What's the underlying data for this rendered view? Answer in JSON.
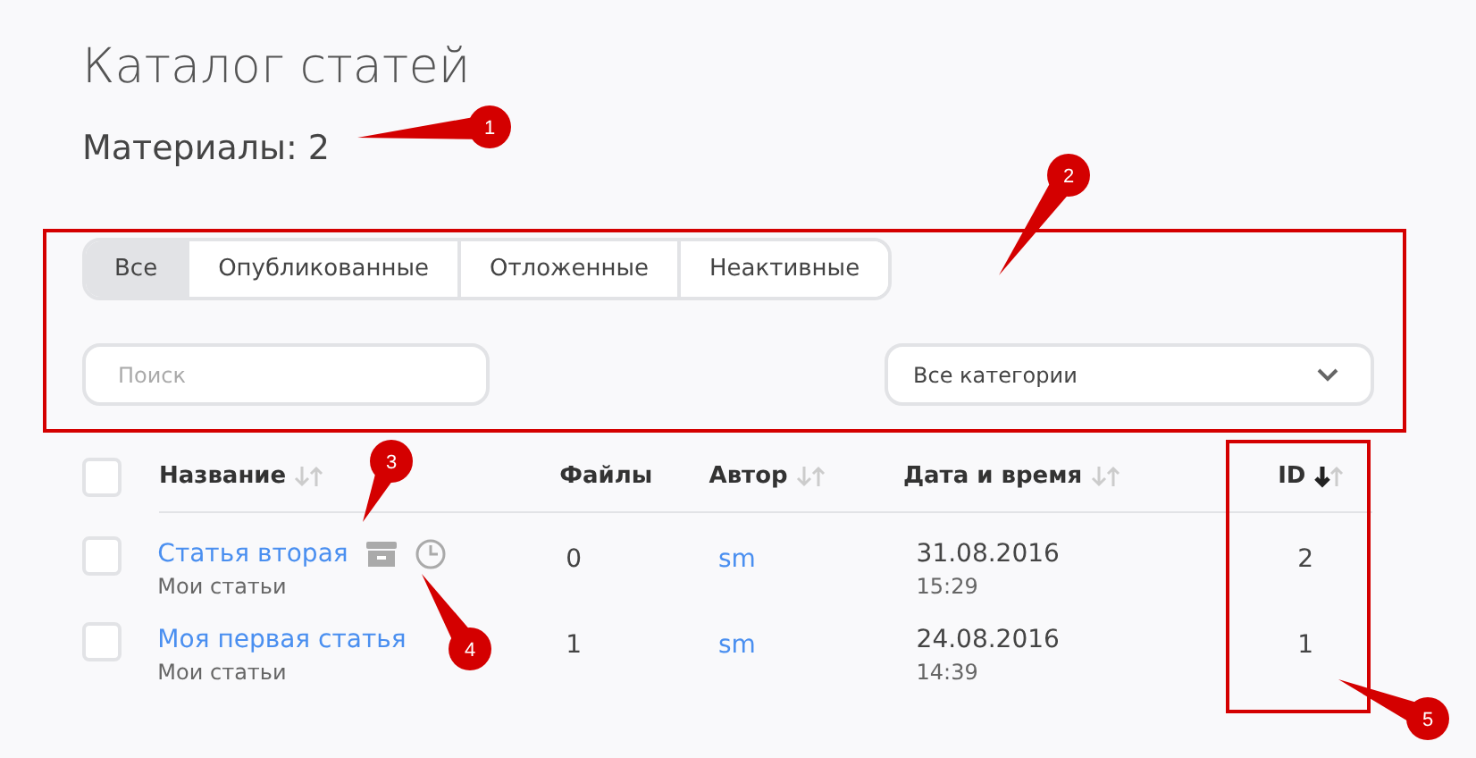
{
  "title": "Каталог статей",
  "materials": "Материалы: 2",
  "tabs": [
    {
      "label": "Все",
      "selected": true
    },
    {
      "label": "Опубликованные",
      "selected": false
    },
    {
      "label": "Отложенные",
      "selected": false
    },
    {
      "label": "Неактивные",
      "selected": false
    }
  ],
  "search": {
    "placeholder": "Поиск"
  },
  "category_select": {
    "value": "Все категории"
  },
  "table": {
    "select_all": {
      "checked": false
    },
    "columns": [
      {
        "label": "Название",
        "sorted_desc": false
      },
      {
        "label": "Файлы"
      },
      {
        "label": "Автор",
        "sorted_desc": false
      },
      {
        "label": "Дата и время",
        "sorted_desc": false
      },
      {
        "label": "ID",
        "sorted_desc": true
      }
    ],
    "rows": [
      {
        "checked": false,
        "title": "Статья вторая",
        "category": "Мои статьи",
        "icons": [
          {
            "kind": "archive"
          },
          {
            "kind": "clock"
          }
        ],
        "files": "0",
        "author": "sm",
        "date": "31.08.2016",
        "time": "15:29",
        "id": "2"
      },
      {
        "checked": false,
        "title": "Моя первая статья",
        "category": "Мои статьи",
        "files": "1",
        "author": "sm",
        "date": "24.08.2016",
        "time": "14:39",
        "id": "1"
      }
    ]
  },
  "callouts": [
    {
      "label": "1"
    },
    {
      "label": "2"
    },
    {
      "label": "3"
    },
    {
      "label": "4"
    },
    {
      "label": "5"
    }
  ]
}
